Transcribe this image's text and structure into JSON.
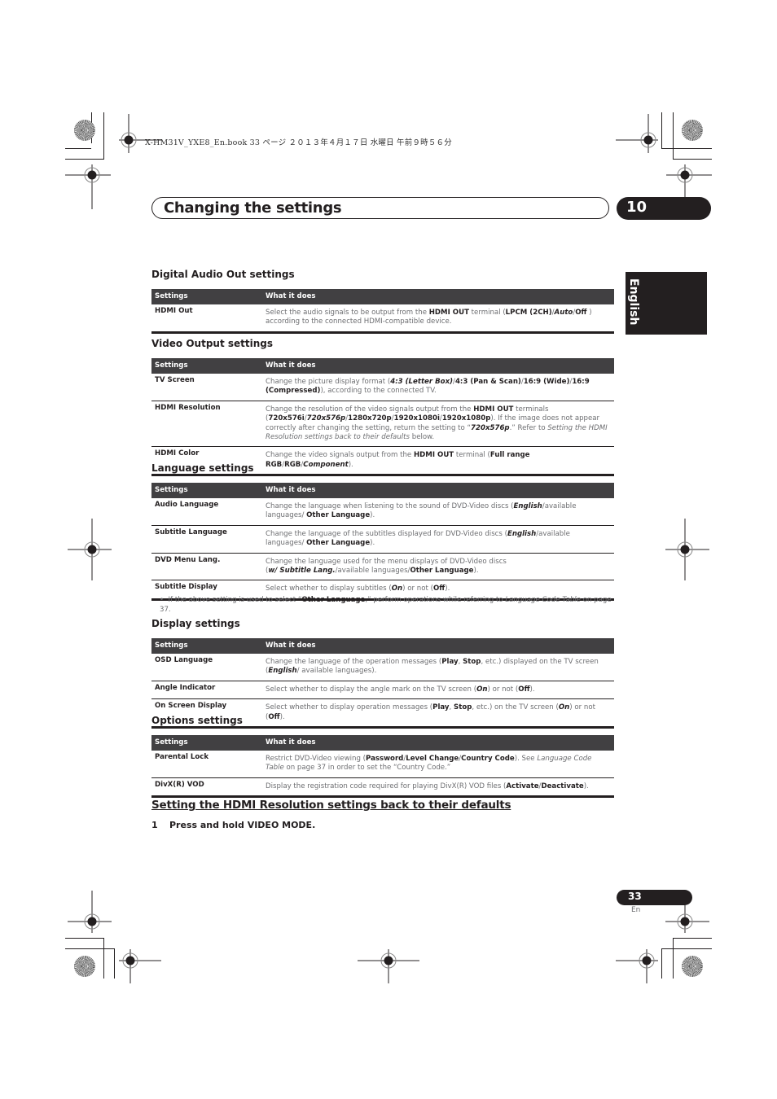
{
  "slug": "X-HM31V_YXE8_En.book  33 ページ  ２０１３年４月１７日  水曜日  午前９時５６分",
  "header": {
    "title": "Changing the settings",
    "chapter": "10"
  },
  "side_tab": "English",
  "columns": {
    "settings": "Settings",
    "what": "What it does"
  },
  "sections": {
    "digital_audio": {
      "title": "Digital Audio Out settings",
      "rows": [
        {
          "name": "HDMI Out",
          "desc": "Select the audio signals to be output from the <b>HDMI OUT</b> terminal (<b>LPCM (2CH)</b>/<i class=\"em\">Auto</i>/<b>Off</b> ) according to the connected HDMI-compatible device."
        }
      ]
    },
    "video_output": {
      "title": "Video Output settings",
      "rows": [
        {
          "name": "TV Screen",
          "desc": "Change the picture display format (<i class=\"em\">4:3 (Letter Box)</i>/<b>4:3 (Pan &amp; Scan)</b>/<b>16:9 (Wide)</b>/<b>16:9 (Compressed)</b>), according to the connected TV."
        },
        {
          "name": "HDMI Resolution",
          "desc": "Change the resolution of the video signals output from the <b>HDMI OUT</b> terminals (<b>720x576i</b>/<i class=\"em\">720x576p</i>/<b>1280x720p</b>/<b>1920x1080i</b>/<b>1920x1080p</b>). If the image does not appear correctly after changing the setting, return the setting to “<i class=\"em\">720x576p</i>.” Refer to <i>Setting the HDMI Resolution settings back to their defaults</i> below."
        },
        {
          "name": "HDMI Color",
          "desc": "Change the video signals output from the <b>HDMI OUT</b> terminal (<b>Full range RGB</b>/<b>RGB</b>/<i class=\"em\">Component</i>)."
        }
      ]
    },
    "language": {
      "title": "Language settings",
      "rows": [
        {
          "name": "Audio Language",
          "desc": "Change the language when listening to the sound of DVD-Video discs (<i class=\"em\">English</i>/available languages/ <b>Other Language</b>)."
        },
        {
          "name": "Subtitle Language",
          "desc": "Change the language of the subtitles displayed for DVD-Video discs (<i class=\"em\">English</i>/available languages/ <b>Other Language</b>)."
        },
        {
          "name": "DVD Menu Lang.",
          "desc": "Change the language used for the menu displays of DVD-Video discs<br>(<i class=\"em\">w/ Subtitle Lang.</i>/available languages/<b>Other Language</b>)."
        },
        {
          "name": "Subtitle Display",
          "desc": "Select whether to display subtitles (<i class=\"em\">On</i>) or not (<b>Off</b>)."
        }
      ],
      "note": "•&nbsp;&nbsp;If the above setting is used to select “<b>Other Language</b>,” perform operations while referring to <i>Language Code Table</i> on page 37."
    },
    "display": {
      "title": "Display settings",
      "rows": [
        {
          "name": "OSD Language",
          "desc": "Change the language of the operation messages (<b>Play</b>, <b>Stop</b>, etc.) displayed on the TV screen (<i class=\"em\">English</i>/ available languages)."
        },
        {
          "name": "Angle Indicator",
          "desc": "Select whether to display the angle mark on the TV screen (<i class=\"em\">On</i>) or not (<b>Off</b>)."
        },
        {
          "name": "On Screen Display",
          "desc": "Select whether to display operation messages (<b>Play</b>, <b>Stop</b>, etc.) on the TV screen (<i class=\"em\">On</i>) or not (<b>Off</b>)."
        }
      ]
    },
    "options": {
      "title": "Options settings",
      "rows": [
        {
          "name": "Parental Lock",
          "desc": "Restrict DVD-Video viewing (<b>Password</b>/<b>Level Change</b>/<b>Country Code</b>). See <i>Language Code Table</i> on page 37 in order to set the “Country Code.”"
        },
        {
          "name": "DivX(R) VOD",
          "desc": "Display the registration code required for playing DivX(R) VOD files (<b>Activate</b>/<b>Deactivate</b>)."
        }
      ]
    }
  },
  "defaults_section": {
    "title": "Setting the HDMI Resolution settings back to their defaults",
    "step_number": "1",
    "step_text": "Press and hold VIDEO MODE."
  },
  "footer": {
    "page": "33",
    "lang": "En"
  }
}
